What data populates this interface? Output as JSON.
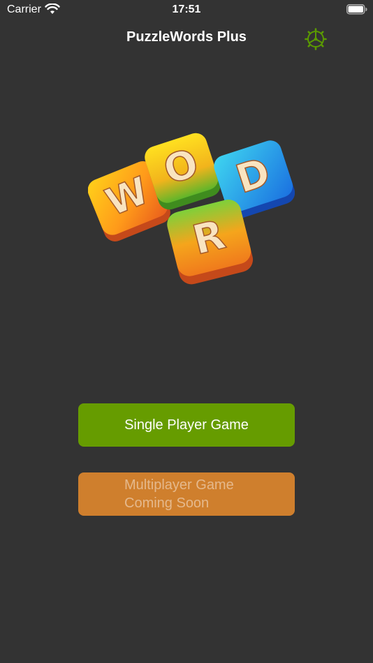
{
  "status_bar": {
    "carrier": "Carrier",
    "time": "17:51",
    "wifi_icon": "wifi-icon",
    "battery_icon": "battery-icon"
  },
  "nav": {
    "title": "PuzzleWords Plus",
    "settings_icon": "gear-icon",
    "accent_color": "#5a9a00"
  },
  "logo": {
    "letters": [
      "W",
      "O",
      "D",
      "R"
    ],
    "text": "WORD"
  },
  "buttons": {
    "single_player": "Single Player Game",
    "multiplayer_line1": "Multiplayer Game",
    "multiplayer_line2": "Coming Soon",
    "single_color": "#669c00",
    "multi_color": "#cf7f2d"
  },
  "colors": {
    "background": "#333333"
  }
}
